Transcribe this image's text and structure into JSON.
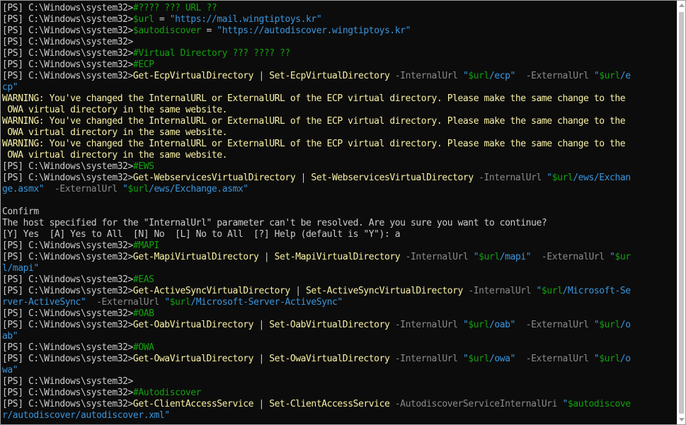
{
  "window": {
    "title": "",
    "lines": [
      {
        "segments": [
          [
            "prompt",
            "[PS] C:\\Windows\\system32>"
          ],
          [
            "comment",
            "#???? ??? URL ??"
          ]
        ]
      },
      {
        "segments": [
          [
            "prompt",
            "[PS] C:\\Windows\\system32>"
          ],
          [
            "var",
            "$url"
          ],
          [
            "op",
            " = "
          ],
          [
            "string",
            "\"https://mail.wingtiptoys.kr\""
          ]
        ]
      },
      {
        "segments": [
          [
            "prompt",
            "[PS] C:\\Windows\\system32>"
          ],
          [
            "var",
            "$autodiscover"
          ],
          [
            "op",
            " = "
          ],
          [
            "string",
            "\"https://autodiscover.wingtiptoys.kr\""
          ]
        ]
      },
      {
        "segments": [
          [
            "prompt",
            "[PS] C:\\Windows\\system32>"
          ]
        ]
      },
      {
        "segments": [
          [
            "prompt",
            "[PS] C:\\Windows\\system32>"
          ],
          [
            "comment",
            "#Virtual Directory ??? ???? ??"
          ]
        ]
      },
      {
        "segments": [
          [
            "prompt",
            "[PS] C:\\Windows\\system32>"
          ],
          [
            "comment",
            "#ECP"
          ]
        ]
      },
      {
        "segments": [
          [
            "prompt",
            "[PS] C:\\Windows\\system32>"
          ],
          [
            "cmd",
            "Get-EcpVirtualDirectory"
          ],
          [
            "op",
            " | "
          ],
          [
            "cmd",
            "Set-EcpVirtualDirectory"
          ],
          [
            "param",
            " -InternalUrl "
          ],
          [
            "string",
            "\""
          ],
          [
            "strvar",
            "$url"
          ],
          [
            "string",
            "/ecp\""
          ],
          [
            "param",
            "  -ExternalUrl "
          ],
          [
            "string",
            "\""
          ],
          [
            "strvar",
            "$url"
          ],
          [
            "string",
            "/e"
          ]
        ]
      },
      {
        "segments": [
          [
            "string",
            "cp\""
          ]
        ]
      },
      {
        "segments": [
          [
            "warn",
            "WARNING: You've changed the InternalURL or ExternalURL of the ECP virtual directory. Please make the same change to the"
          ]
        ]
      },
      {
        "segments": [
          [
            "warn",
            " OWA virtual directory in the same website."
          ]
        ]
      },
      {
        "segments": [
          [
            "warn",
            "WARNING: You've changed the InternalURL or ExternalURL of the ECP virtual directory. Please make the same change to the"
          ]
        ]
      },
      {
        "segments": [
          [
            "warn",
            " OWA virtual directory in the same website."
          ]
        ]
      },
      {
        "segments": [
          [
            "warn",
            "WARNING: You've changed the InternalURL or ExternalURL of the ECP virtual directory. Please make the same change to the"
          ]
        ]
      },
      {
        "segments": [
          [
            "warn",
            " OWA virtual directory in the same website."
          ]
        ]
      },
      {
        "segments": [
          [
            "prompt",
            "[PS] C:\\Windows\\system32>"
          ],
          [
            "comment",
            "#EWS"
          ]
        ]
      },
      {
        "segments": [
          [
            "prompt",
            "[PS] C:\\Windows\\system32>"
          ],
          [
            "cmd",
            "Get-WebservicesVirtualDirectory"
          ],
          [
            "op",
            " | "
          ],
          [
            "cmd",
            "Set-WebservicesVirtualDirectory"
          ],
          [
            "param",
            " -InternalUrl "
          ],
          [
            "string",
            "\""
          ],
          [
            "strvar",
            "$url"
          ],
          [
            "string",
            "/ews/Exchan"
          ]
        ]
      },
      {
        "segments": [
          [
            "string",
            "ge.asmx\""
          ],
          [
            "param",
            "  -ExternalUrl "
          ],
          [
            "string",
            "\""
          ],
          [
            "strvar",
            "$url"
          ],
          [
            "string",
            "/ews/Exchange.asmx\""
          ]
        ]
      },
      {
        "segments": [
          [
            "plain",
            ""
          ]
        ]
      },
      {
        "segments": [
          [
            "plain",
            "Confirm"
          ]
        ]
      },
      {
        "segments": [
          [
            "plain",
            "The host specified for the \"InternalUrl\" parameter can't be resolved. Are you sure you want to continue?"
          ]
        ]
      },
      {
        "segments": [
          [
            "plain",
            "[Y] Yes  [A] Yes to All  [N] No  [L] No to All  [?] Help (default is \"Y\"): a"
          ]
        ]
      },
      {
        "segments": [
          [
            "prompt",
            "[PS] C:\\Windows\\system32>"
          ],
          [
            "comment",
            "#MAPI"
          ]
        ]
      },
      {
        "segments": [
          [
            "prompt",
            "[PS] C:\\Windows\\system32>"
          ],
          [
            "cmd",
            "Get-MapiVirtualDirectory"
          ],
          [
            "op",
            " | "
          ],
          [
            "cmd",
            "Set-MapiVirtualDirectory"
          ],
          [
            "param",
            " -InternalUrl "
          ],
          [
            "string",
            "\""
          ],
          [
            "strvar",
            "$url"
          ],
          [
            "string",
            "/mapi\""
          ],
          [
            "param",
            "  -ExternalUrl "
          ],
          [
            "string",
            "\""
          ],
          [
            "strvar",
            "$ur"
          ]
        ]
      },
      {
        "segments": [
          [
            "string",
            "l/mapi\""
          ]
        ]
      },
      {
        "segments": [
          [
            "prompt",
            "[PS] C:\\Windows\\system32>"
          ],
          [
            "comment",
            "#EAS"
          ]
        ]
      },
      {
        "segments": [
          [
            "prompt",
            "[PS] C:\\Windows\\system32>"
          ],
          [
            "cmd",
            "Get-ActiveSyncVirtualDirectory"
          ],
          [
            "op",
            " | "
          ],
          [
            "cmd",
            "Set-ActiveSyncVirtualDirectory"
          ],
          [
            "param",
            " -InternalUrl "
          ],
          [
            "string",
            "\""
          ],
          [
            "strvar",
            "$url"
          ],
          [
            "string",
            "/Microsoft-Se"
          ]
        ]
      },
      {
        "segments": [
          [
            "string",
            "rver-ActiveSync\""
          ],
          [
            "param",
            "  -ExternalUrl "
          ],
          [
            "string",
            "\""
          ],
          [
            "strvar",
            "$url"
          ],
          [
            "string",
            "/Microsoft-Server-ActiveSync\""
          ]
        ]
      },
      {
        "segments": [
          [
            "prompt",
            "[PS] C:\\Windows\\system32>"
          ],
          [
            "comment",
            "#OAB"
          ]
        ]
      },
      {
        "segments": [
          [
            "prompt",
            "[PS] C:\\Windows\\system32>"
          ],
          [
            "cmd",
            "Get-OabVirtualDirectory"
          ],
          [
            "op",
            " | "
          ],
          [
            "cmd",
            "Set-OabVirtualDirectory"
          ],
          [
            "param",
            " -InternalUrl "
          ],
          [
            "string",
            "\""
          ],
          [
            "strvar",
            "$url"
          ],
          [
            "string",
            "/oab\""
          ],
          [
            "param",
            "  -ExternalUrl "
          ],
          [
            "string",
            "\""
          ],
          [
            "strvar",
            "$url"
          ],
          [
            "string",
            "/o"
          ]
        ]
      },
      {
        "segments": [
          [
            "string",
            "ab\""
          ]
        ]
      },
      {
        "segments": [
          [
            "prompt",
            "[PS] C:\\Windows\\system32>"
          ],
          [
            "comment",
            "#OWA"
          ]
        ]
      },
      {
        "segments": [
          [
            "prompt",
            "[PS] C:\\Windows\\system32>"
          ],
          [
            "cmd",
            "Get-OwaVirtualDirectory"
          ],
          [
            "op",
            " | "
          ],
          [
            "cmd",
            "Set-OwaVirtualDirectory"
          ],
          [
            "param",
            " -InternalUrl "
          ],
          [
            "string",
            "\""
          ],
          [
            "strvar",
            "$url"
          ],
          [
            "string",
            "/owa\""
          ],
          [
            "param",
            "  -ExternalUrl "
          ],
          [
            "string",
            "\""
          ],
          [
            "strvar",
            "$url"
          ],
          [
            "string",
            "/o"
          ]
        ]
      },
      {
        "segments": [
          [
            "string",
            "wa\""
          ]
        ]
      },
      {
        "segments": [
          [
            "prompt",
            "[PS] C:\\Windows\\system32>"
          ]
        ]
      },
      {
        "segments": [
          [
            "prompt",
            "[PS] C:\\Windows\\system32>"
          ],
          [
            "comment",
            "#Autodiscover"
          ]
        ]
      },
      {
        "segments": [
          [
            "prompt",
            "[PS] C:\\Windows\\system32>"
          ],
          [
            "cmd",
            "Get-ClientAccessService"
          ],
          [
            "op",
            " | "
          ],
          [
            "cmd",
            "Set-ClientAccessService"
          ],
          [
            "param",
            " -AutodiscoverServiceInternalUri "
          ],
          [
            "string",
            "\""
          ],
          [
            "strvar",
            "$autodiscove"
          ]
        ]
      },
      {
        "segments": [
          [
            "string",
            "r/autodiscover/autodiscover.xml\""
          ]
        ]
      }
    ]
  },
  "colors": {
    "background": "#0c0c0c",
    "prompt": "#cccccc",
    "comment": "#13a10e",
    "variable": "#13a10e",
    "command": "#f9f1a5",
    "parameter": "#8a8a8a",
    "string": "#3a96dd",
    "warning": "#f9f1a5"
  },
  "icons": {
    "scroll_up": "chevron-up-icon",
    "scroll_down": "chevron-down-icon"
  }
}
